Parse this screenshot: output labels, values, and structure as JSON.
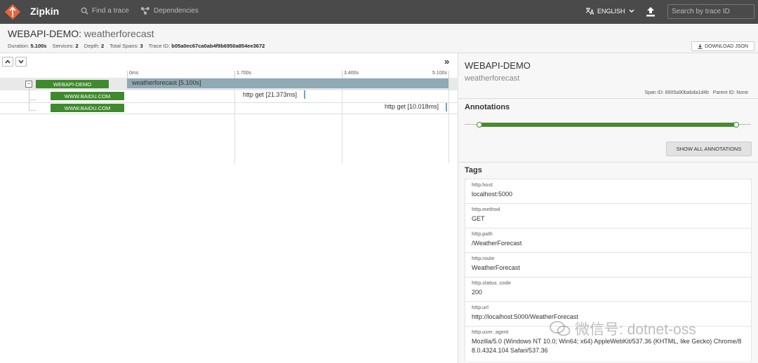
{
  "nav": {
    "brand": "Zipkin",
    "find_trace": "Find a trace",
    "dependencies": "Dependencies",
    "language": "ENGLISH",
    "search_placeholder": "Search by trace ID",
    "colors": {
      "bar": "#4a4a4a",
      "logo": "#e8643c"
    }
  },
  "header": {
    "service": "WEBAPI-DEMO:",
    "operation": "weatherforecast",
    "meta": {
      "duration_label": "Duration:",
      "duration": "5.100s",
      "services_label": "Services:",
      "services": "2",
      "depth_label": "Depth:",
      "depth": "2",
      "spans_label": "Total Spans:",
      "spans": "3",
      "traceid_label": "Trace ID:",
      "traceid": "b05a0ec67ca0ab4f9b6950a854ee3672"
    },
    "download_json": "DOWNLOAD JSON"
  },
  "timeline": {
    "ticks": [
      "0ms",
      "1.700s",
      "3.400s",
      "5.100s"
    ],
    "spans": [
      {
        "service": "WEBAPI-DEMO",
        "label": "weatherforecast [5.100s]"
      },
      {
        "service": "WWW.BAIDU.COM",
        "label": "http get [21.373ms]"
      },
      {
        "service": "WWW.BAIDU.COM",
        "label": "http get [10.018ms]"
      }
    ],
    "colors": {
      "service": "#3e8a2c",
      "span": "#8fa9b5"
    }
  },
  "detail": {
    "service": "WEBAPI-DEMO",
    "operation": "weatherforecast",
    "span_id_label": "Span ID:",
    "span_id": "8905a90babda1d4b",
    "parent_id_label": "Parent ID:",
    "parent_id": "None",
    "annotations_title": "Annotations",
    "show_all": "SHOW ALL ANNOTATIONS",
    "tags_title": "Tags",
    "tags": [
      {
        "key": "http.host",
        "value": "localhost:5000"
      },
      {
        "key": "http.method",
        "value": "GET"
      },
      {
        "key": "http.path",
        "value": "/WeatherForecast"
      },
      {
        "key": "http.route",
        "value": "WeatherForecast"
      },
      {
        "key": "http.status_code",
        "value": "200"
      },
      {
        "key": "http.url",
        "value": "http://localhost:5000/WeatherForecast"
      },
      {
        "key": "http.user_agent",
        "value": "Mozilla/5.0 (Windows NT 10.0; Win64; x64) AppleWebKit/537.36 (KHTML, like Gecko) Chrome/88.0.4324.104 Safari/537.36"
      }
    ]
  },
  "watermark": "微信号: dotnet-oss"
}
